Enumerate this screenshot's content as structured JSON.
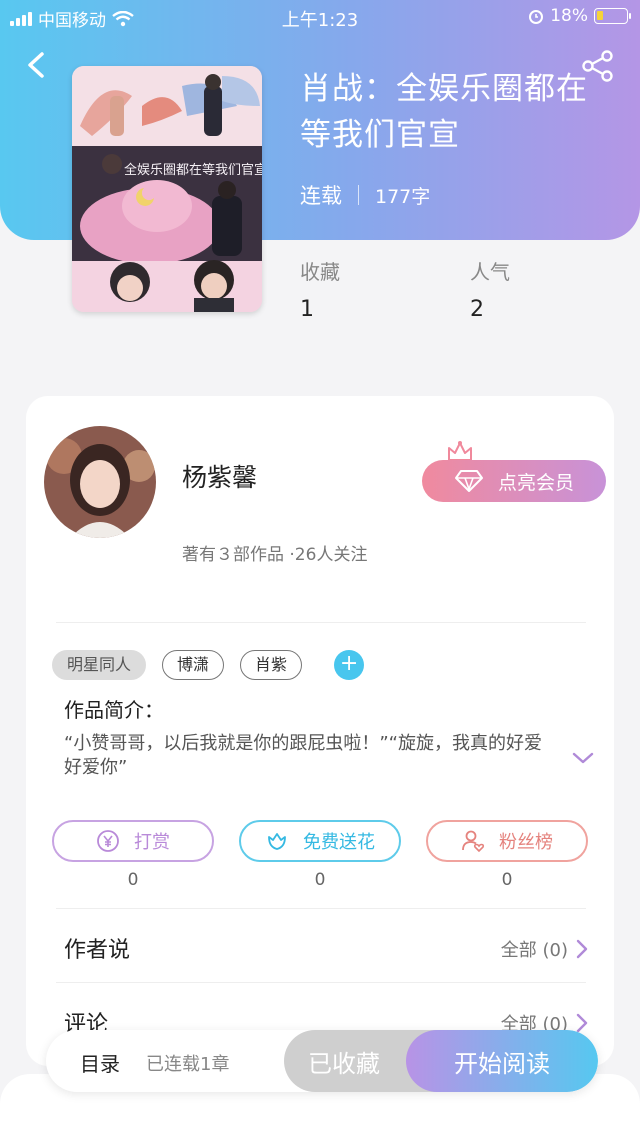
{
  "status_bar": {
    "carrier": "中国移动",
    "time": "上午1:23",
    "battery": "18%"
  },
  "book": {
    "title": "肖战：全娱乐圈都在等我们官宣",
    "status": "连载",
    "word_count": "177字",
    "stats": [
      {
        "label": "收藏",
        "value": "1"
      },
      {
        "label": "人气",
        "value": "2"
      }
    ]
  },
  "cover": {
    "overlay_text": "全娱乐圈都在等我们官宣"
  },
  "author": {
    "name": "杨紫馨",
    "meta": "著有３部作品 ·26人关注",
    "vip_label": "点亮会员"
  },
  "tags": [
    "明星同人",
    "博潇",
    "肖紫"
  ],
  "intro": {
    "label": "作品简介：",
    "text": "“小赞哥哥，以后我就是你的跟屁虫啦！”“旋旋，我真的好爱好爱你”"
  },
  "actions": [
    {
      "label": "打赏",
      "count": "0",
      "icon": "yen-icon",
      "color": "#b98ad9"
    },
    {
      "label": "免费送花",
      "count": "0",
      "icon": "flower-icon",
      "color": "#4cc4e8"
    },
    {
      "label": "粉丝榜",
      "count": "0",
      "icon": "person-heart-icon",
      "color": "#ee8f8a"
    }
  ],
  "sections": [
    {
      "title": "作者说",
      "link": "全部 (0)"
    },
    {
      "title": "评论",
      "link": "全部 (0)"
    }
  ],
  "bottom_bar": {
    "toc_label": "目录",
    "chapter_info": "已连载1章",
    "collected_label": "已收藏",
    "read_label": "开始阅读"
  },
  "colors": {
    "hero_gradient": [
      "#58c8f0",
      "#b496e6"
    ],
    "accent_blue": "#48c6ee",
    "chevron_purple": "#b08ad8"
  }
}
